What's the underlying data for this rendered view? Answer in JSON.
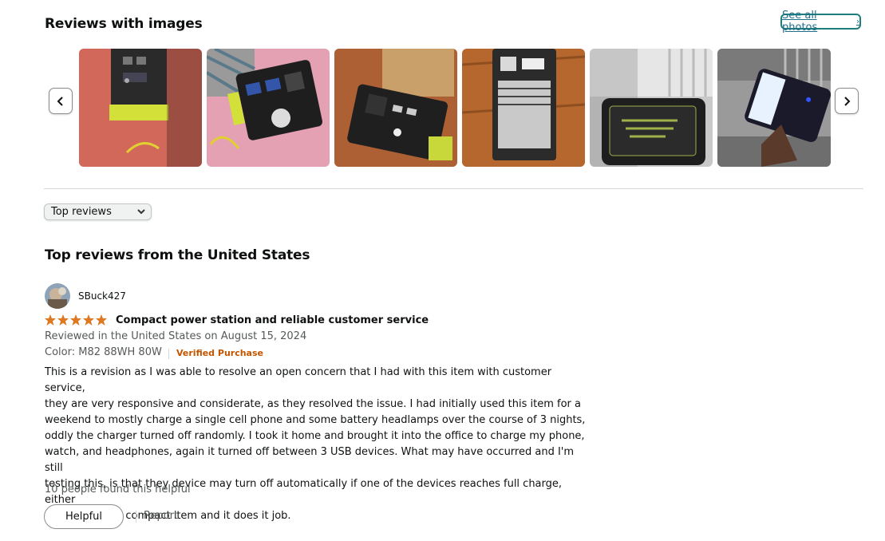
{
  "images_section": {
    "title": "Reviews with images",
    "see_all_label": "See all photos",
    "thumbnails": [
      {
        "icon": "review-photo-1-icon"
      },
      {
        "icon": "review-photo-2-icon"
      },
      {
        "icon": "review-photo-3-icon"
      },
      {
        "icon": "review-photo-4-icon"
      },
      {
        "icon": "review-photo-5-icon"
      },
      {
        "icon": "review-photo-6-icon"
      }
    ]
  },
  "sort": {
    "selected": "Top reviews"
  },
  "top_reviews": {
    "heading": "Top reviews from the United States",
    "review": {
      "author": "SBuck427",
      "rating": 5,
      "title": "Compact power station and reliable customer service",
      "reviewed_line": "Reviewed in the United States on August 15, 2024",
      "variant": "Color: M82 88WH 80W",
      "verified": "Verified Purchase",
      "body_lines": [
        "This is a revision as I was able to resolve an open concern that I had with this item with customer service,",
        "they are very responsive and considerate, as they resolved the issue. I had initially used this item for a",
        "weekend to mostly charge a single cell phone and some battery headlamps over the course of 3 nights,",
        "oddly the charger turned off randomly. I took it home and brought it into the office to charge my phone,",
        "watch, and headphones, again it turned off between 3 USB devices. What may have occurred and I'm still",
        "testing this, is that they device may turn off automatically if one of the devices reaches full charge, either",
        "way, this still a compact item and it does it job."
      ],
      "helpful_count": "10 people found this helpful",
      "helpful_button": "Helpful",
      "report_label": "Report"
    }
  },
  "colors": {
    "star": "#de7921",
    "link": "#1f6f8b",
    "verified": "#c45500"
  }
}
